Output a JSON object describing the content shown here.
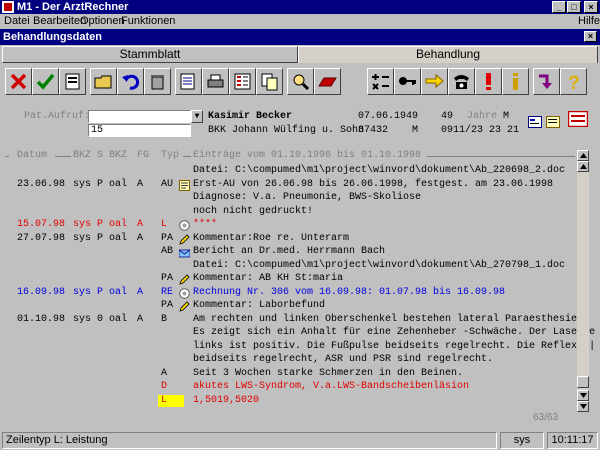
{
  "window": {
    "title": "M1 - Der ArztRechner"
  },
  "menu": [
    "Datei",
    "Bearbeiten",
    "Optionen",
    "Funktionen"
  ],
  "menu_help": "Hilfe",
  "subwindow": {
    "title": "Behandlungsdaten"
  },
  "tabs": [
    {
      "label": "Stammblatt",
      "active": false
    },
    {
      "label": "Behandlung",
      "active": true
    }
  ],
  "toolbar": {
    "buttons": [
      "cancel-icon",
      "ok-icon",
      "print-preview-icon",
      "open-folder-icon",
      "undo-icon",
      "trash-icon",
      "document-list-icon",
      "printer-icon",
      "checklist-icon",
      "copy-icon",
      "search-person-icon",
      "eraser-icon",
      "calculator-icon",
      "key-icon",
      "direction-arrow-icon",
      "telephone-icon",
      "exclamation-icon",
      "info-icon",
      "return-arrow-icon",
      "help-icon"
    ]
  },
  "patient": {
    "aufruf_label": "Pat.Aufruf:",
    "aufruf_value": "",
    "field2_value": "15",
    "name": "Kasimir Becker",
    "birthdate": "07.06.1949",
    "age": "49",
    "age_unit": "Jahre",
    "sex": "M",
    "insurance": "BKK Johann Wülfing u. Sohn",
    "zip": "37432",
    "status": "M",
    "phone": "0911/23 23 21"
  },
  "list": {
    "headers": {
      "datum": "Datum",
      "bkz": "BKZ",
      "s": "S",
      "bkz2": "BKZ",
      "fg": "FG",
      "typ": "Typ",
      "eintraege": "Einträge vom 01.10.1996 bis 01.10.1998"
    },
    "rows": [
      {
        "date": "",
        "user": "",
        "c3": "",
        "c4": "",
        "c5": "",
        "typ": "",
        "text": "Datei: C:\\compumed\\m1\\project\\winvord\\dokument\\Ab_220698_2.doc",
        "style": "normal",
        "icon": ""
      },
      {
        "date": "23.06.98",
        "user": "sys",
        "c3": "P",
        "c4": "oal",
        "c5": "A",
        "typ": "AU",
        "text": "Erst-AU von 26.06.98 bis 26.06.1998, festgest. am 23.06.1998",
        "style": "normal",
        "icon": "note-icon"
      },
      {
        "date": "",
        "user": "",
        "c3": "",
        "c4": "",
        "c5": "",
        "typ": "",
        "text": "Diagnose: V.a. Pneumonie, BWS-Skoliose",
        "style": "normal",
        "icon": ""
      },
      {
        "date": "",
        "user": "",
        "c3": "",
        "c4": "",
        "c5": "",
        "typ": "",
        "text": "noch nicht gedruckt!",
        "style": "normal",
        "icon": ""
      },
      {
        "date": "15.07.98",
        "user": "sys",
        "c3": "P",
        "c4": "oal",
        "c5": "A",
        "typ": "L",
        "text": "****",
        "style": "red",
        "icon": "circle-icon"
      },
      {
        "date": "27.07.98",
        "user": "sys",
        "c3": "P",
        "c4": "oal",
        "c5": "A",
        "typ": "PA",
        "text": "Kommentar:Roe re. Unterarm",
        "style": "normal",
        "icon": "pencil-icon"
      },
      {
        "date": "",
        "user": "",
        "c3": "",
        "c4": "",
        "c5": "",
        "typ": "AB",
        "text": "Bericht an Dr.med. Herrmann Bach",
        "style": "normal",
        "icon": "letter-icon"
      },
      {
        "date": "",
        "user": "",
        "c3": "",
        "c4": "",
        "c5": "",
        "typ": "",
        "text": "Datei: C:\\compumed\\m1\\project\\winvord\\dokument\\Ab_270798_1.doc",
        "style": "normal",
        "icon": ""
      },
      {
        "date": "",
        "user": "",
        "c3": "",
        "c4": "",
        "c5": "",
        "typ": "PA",
        "text": "Kommentar: AB KH St:maria",
        "style": "normal",
        "icon": "pencil-icon"
      },
      {
        "date": "16.09.98",
        "user": "sys",
        "c3": "P",
        "c4": "oal",
        "c5": "A",
        "typ": "RE",
        "text": "Rechnung Nr. 306 vom 16.09.98: 01.07.98 bis 16.09.98",
        "style": "blue",
        "icon": "circle-icon"
      },
      {
        "date": "",
        "user": "",
        "c3": "",
        "c4": "",
        "c5": "",
        "typ": "PA",
        "text": "Kommentar: Laborbefund",
        "style": "normal",
        "icon": "pencil-icon"
      },
      {
        "date": "01.10.98",
        "user": "sys",
        "c3": "0",
        "c4": "oal",
        "c5": "A",
        "typ": "B",
        "text": "Am rechten und linken Oberschenkel bestehen lateral Paraesthesien.",
        "style": "normal",
        "icon": ""
      },
      {
        "date": "",
        "user": "",
        "c3": "",
        "c4": "",
        "c5": "",
        "typ": "",
        "text": "Es zeigt sich ein Anhalt für eine Zehenheber -Schwäche. Der Laseque",
        "style": "normal",
        "icon": ""
      },
      {
        "date": "",
        "user": "",
        "c3": "",
        "c4": "",
        "c5": "",
        "typ": "",
        "text": "links ist positiv. Die Fußpulse beidseits regelrecht. Die Reflexe |",
        "style": "normal",
        "icon": ""
      },
      {
        "date": "",
        "user": "",
        "c3": "",
        "c4": "",
        "c5": "",
        "typ": "",
        "text": "beidseits regelrecht, ASR und PSR sind regelrecht.",
        "style": "normal",
        "icon": ""
      },
      {
        "date": "",
        "user": "",
        "c3": "",
        "c4": "",
        "c5": "",
        "typ": "A",
        "text": "Seit 3 Wochen starke Schmerzen in den Beinen.",
        "style": "normal",
        "icon": ""
      },
      {
        "date": "",
        "user": "",
        "c3": "",
        "c4": "",
        "c5": "",
        "typ": "D",
        "text": "akutes LWS-Syndrom, V.a.LWS-Bandscheibenläsion",
        "style": "red",
        "icon": ""
      },
      {
        "date": "",
        "user": "",
        "c3": "",
        "c4": "",
        "c5": "",
        "typ": "L",
        "text": "1,5019,5020",
        "style": "red",
        "icon": "",
        "highlight": true
      }
    ],
    "page_count": "63/63"
  },
  "statusbar": {
    "message": "Zeilentyp L: Leistung",
    "user": "sys",
    "time": "10:11:17"
  }
}
